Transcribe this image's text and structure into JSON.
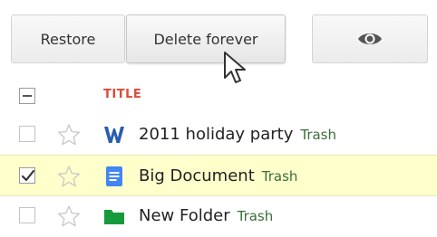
{
  "toolbar": {
    "restore_label": "Restore",
    "delete_forever_label": "Delete forever",
    "view_icon": "eye-icon"
  },
  "list_header": {
    "title_label": "TITLE"
  },
  "files": [
    {
      "name": "2011 holiday party",
      "tag": "Trash",
      "type_icon": "word-document-icon",
      "checked": false,
      "starred": false
    },
    {
      "name": "Big Document",
      "tag": "Trash",
      "type_icon": "google-document-icon",
      "checked": true,
      "starred": false
    },
    {
      "name": "New Folder",
      "tag": "Trash",
      "type_icon": "folder-icon",
      "checked": false,
      "starred": false
    }
  ],
  "colors": {
    "title_header": "#dd4b39",
    "selected_row": "#ffffcc",
    "trash_tag": "#3a6e3a",
    "word_icon": "#2a5db0",
    "doc_icon": "#4285f4",
    "folder_icon": "#159a3c"
  }
}
